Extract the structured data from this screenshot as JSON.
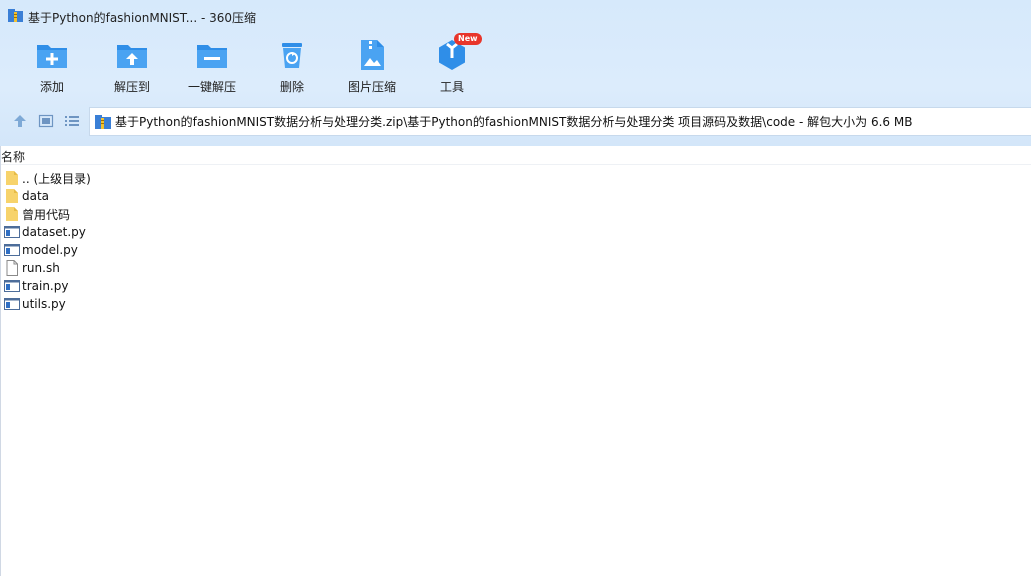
{
  "window": {
    "title": "基于Python的fashionMNIST... - 360压缩"
  },
  "toolbar": {
    "items": [
      {
        "label": "添加",
        "icon": "add-archive-icon"
      },
      {
        "label": "解压到",
        "icon": "extract-to-icon"
      },
      {
        "label": "一键解压",
        "icon": "one-click-extract-icon"
      },
      {
        "label": "删除",
        "icon": "delete-icon"
      },
      {
        "label": "图片压缩",
        "icon": "image-compress-icon"
      },
      {
        "label": "工具",
        "icon": "tools-icon"
      }
    ],
    "new_badge": "New"
  },
  "navigation": {
    "buttons": [
      "up-arrow-icon",
      "view-mode-icon",
      "list-view-icon"
    ],
    "path": "基于Python的fashionMNIST数据分析与处理分类.zip\\基于Python的fashionMNIST数据分析与处理分类 项目源码及数据\\code - 解包大小为 6.6 MB"
  },
  "file_list": {
    "column_header": "名称",
    "rows": [
      {
        "name": ".. (上级目录)",
        "type": "folder"
      },
      {
        "name": "data",
        "type": "folder"
      },
      {
        "name": "曾用代码",
        "type": "folder"
      },
      {
        "name": "dataset.py",
        "type": "python"
      },
      {
        "name": "model.py",
        "type": "python"
      },
      {
        "name": "run.sh",
        "type": "file"
      },
      {
        "name": "train.py",
        "type": "python"
      },
      {
        "name": "utils.py",
        "type": "python"
      }
    ]
  },
  "colors": {
    "toolbar_bg": "#d6e9fb",
    "accent_blue": "#2f8ee8",
    "folder_yellow": "#f7d36b",
    "badge_red": "#e8352b"
  }
}
